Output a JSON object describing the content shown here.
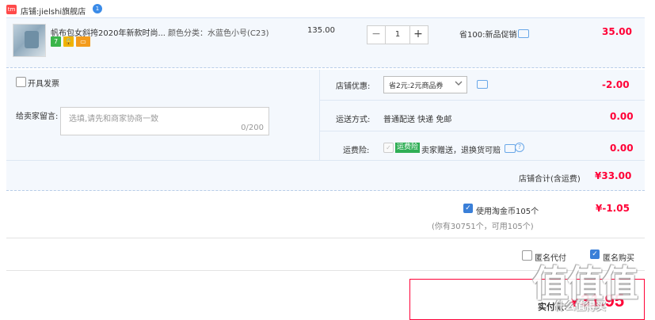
{
  "shop": {
    "icon_label": "tm",
    "label": "店铺:",
    "name": "jielshi旗舰店",
    "ww_label": "1"
  },
  "item": {
    "title": "帆布包女斜挎2020年新款时尚...",
    "sku": "颜色分类：水蓝色小号(C23)",
    "unit_price": "135.00",
    "badges": [
      "7",
      "🔒",
      "▭"
    ],
    "quantity": "1",
    "minus": "−",
    "plus": "+",
    "promo": "省100:新品促销",
    "subtotal": "35.00"
  },
  "invoice": {
    "label": "开具发票"
  },
  "message": {
    "label": "给卖家留言:",
    "placeholder": "选填,请先和商家协商一致",
    "counter": "0/200"
  },
  "coupon": {
    "label": "店铺优惠:",
    "selected": "省2元:2元商品券",
    "value": "-2.00"
  },
  "shipping": {
    "label": "运送方式:",
    "value": "普通配送 快递 免邮",
    "price": "0.00"
  },
  "insurance": {
    "label": "运费险:",
    "badge": "运费险",
    "value": "卖家赠送，退换货可赔",
    "price": "0.00"
  },
  "shop_total": {
    "label": "店铺合计(含运费)",
    "value": "¥33.00"
  },
  "coins": {
    "label": "使用淘金币105个",
    "note": "(你有30751个，可用105个)",
    "value": "¥-1.05"
  },
  "extras": {
    "anon_label": "匿名代付",
    "anon_on": false,
    "anon_buy_label": "匿名购买",
    "anon_buy_on": true
  },
  "payment": {
    "label": "实付款:",
    "currency": "¥",
    "amount": "31.95"
  },
  "watermark": {
    "glyphs": "值值值",
    "subtext": "什么值得买"
  },
  "colors": {
    "accent": "#ff0036",
    "panel": "#f4f8fd",
    "link": "#3a7fd8"
  }
}
